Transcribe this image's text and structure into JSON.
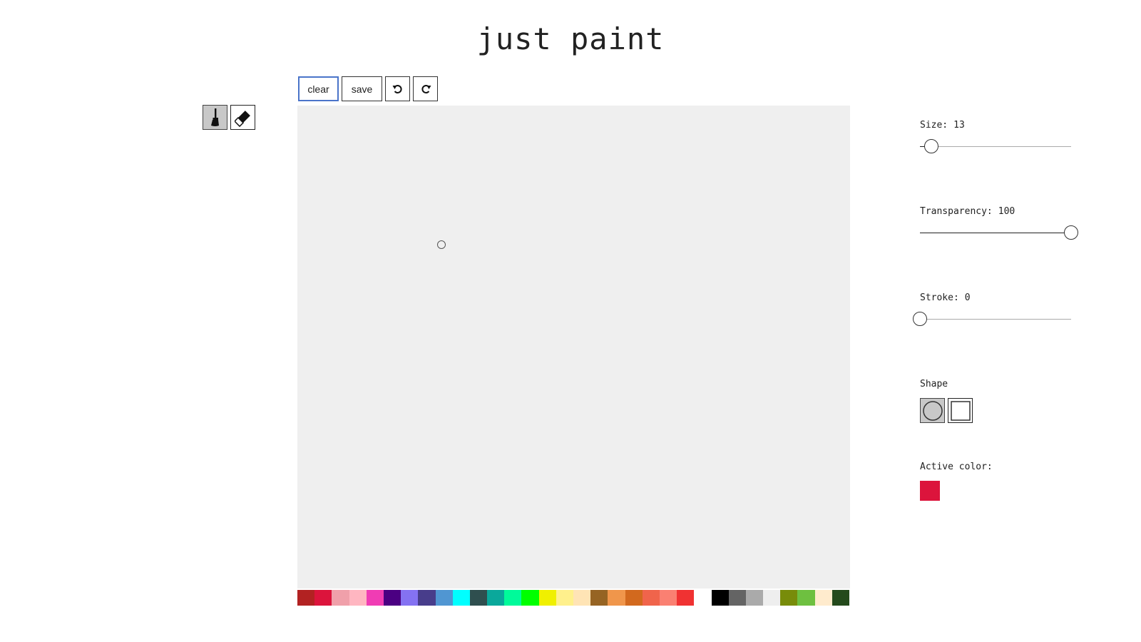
{
  "app": {
    "title": "just paint"
  },
  "toolbar": {
    "clear_label": "clear",
    "save_label": "save",
    "undo_icon": "undo-icon",
    "redo_icon": "redo-icon"
  },
  "tools": [
    {
      "name": "brush-icon",
      "active": true
    },
    {
      "name": "eraser-icon",
      "active": false
    }
  ],
  "settings": {
    "size": {
      "label": "Size:",
      "value": "13",
      "fraction": 0.075
    },
    "transparency": {
      "label": "Transparency:",
      "value": "100",
      "fraction": 1.0
    },
    "stroke": {
      "label": "Stroke:",
      "value": "0",
      "fraction": 0.0
    },
    "shape_label": "Shape",
    "shapes": [
      {
        "name": "circle-shape-icon",
        "active": true
      },
      {
        "name": "square-shape-icon",
        "active": false
      }
    ],
    "active_color_label": "Active color:",
    "active_color": "#dc143c"
  },
  "palette": [
    "#b22222",
    "#dc143c",
    "#f0a0aa",
    "#ffb6c1",
    "#f03cb4",
    "#4b0082",
    "#8472f2",
    "#483d8b",
    "#5096d2",
    "#00ffff",
    "#2f4f4f",
    "#0aa89b",
    "#00fa9a",
    "#00ff00",
    "#f0f000",
    "#fff08c",
    "#ffe4b5",
    "#966423",
    "#f0964b",
    "#d2691e",
    "#f0644b",
    "#fa8072",
    "#f03232",
    "#ffffff",
    "#000000",
    "#646464",
    "#aaaaaa",
    "#eeeeee",
    "#788c0a",
    "#6ec040",
    "#ffebcd",
    "#244a1c"
  ]
}
